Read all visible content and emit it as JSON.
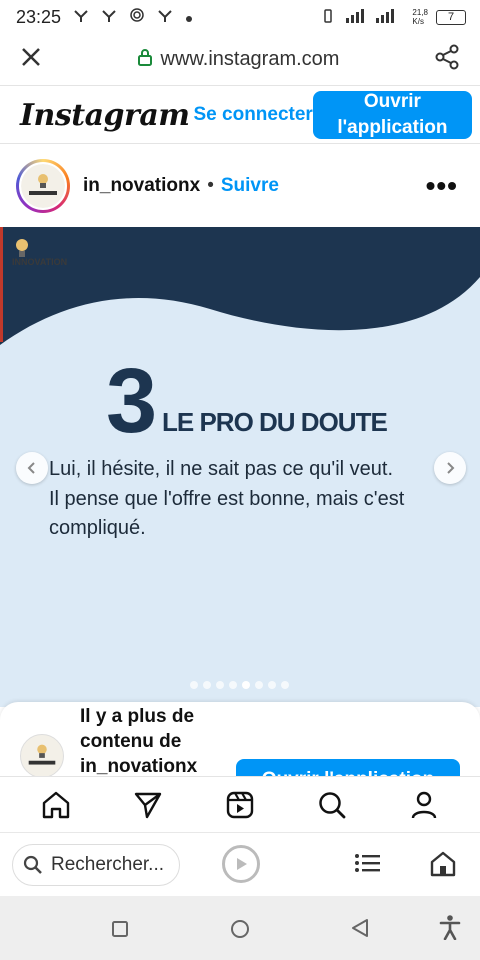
{
  "status_bar": {
    "time": "23:25",
    "network_speed": "21,8\nK/s",
    "battery": "7"
  },
  "browser": {
    "url": "www.instagram.com"
  },
  "ig_header": {
    "logo": "Instagram",
    "login_label": "Se connecter",
    "open_app_label": "Ouvrir\nl'application"
  },
  "post": {
    "username": "in_novationx",
    "separator": "•",
    "follow_label": "Suivre",
    "more_label": "•••",
    "image": {
      "brand": "INNOVATION",
      "number": "3",
      "subtitle": "LE PRO DU DOUTE",
      "text_line1": "Lui, il hésite, il ne sait pas ce qu'il veut.",
      "text_line2": "Il pense que l'offre est bonne, mais c'est compliqué."
    },
    "carousel": {
      "count": 8,
      "active_index": 4
    }
  },
  "sheet": {
    "text": "Il y a plus de contenu de in_novationx",
    "button_label": "Ouvrir l'application"
  },
  "browser_bar": {
    "search_placeholder": "Rechercher..."
  },
  "colors": {
    "instagram_blue": "#0095f6",
    "post_navy": "#1d3550",
    "post_background": "#dceaf6"
  }
}
